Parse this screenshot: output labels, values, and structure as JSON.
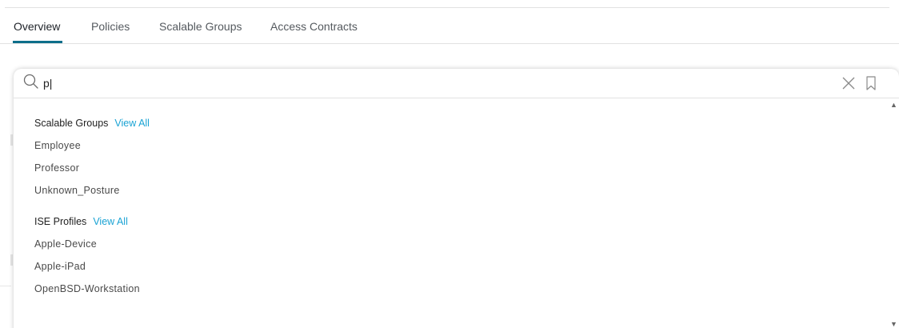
{
  "tabs": [
    {
      "label": "Overview",
      "active": true
    },
    {
      "label": "Policies",
      "active": false
    },
    {
      "label": "Scalable Groups",
      "active": false
    },
    {
      "label": "Access Contracts",
      "active": false
    }
  ],
  "search": {
    "value": "p|",
    "icons": {
      "search": "search-icon",
      "clear": "close-icon",
      "bookmark": "bookmark-icon"
    }
  },
  "results": {
    "groups": [
      {
        "title": "Scalable Groups",
        "view_all": "View All",
        "items": [
          "Employee",
          "Professor",
          "Unknown_Posture"
        ]
      },
      {
        "title": "ISE Profiles",
        "view_all": "View All",
        "items": [
          "Apple-Device",
          "Apple-iPad",
          "OpenBSD-Workstation"
        ]
      }
    ]
  },
  "colors": {
    "accent": "#0d6e8a",
    "link": "#1aa3d4"
  }
}
